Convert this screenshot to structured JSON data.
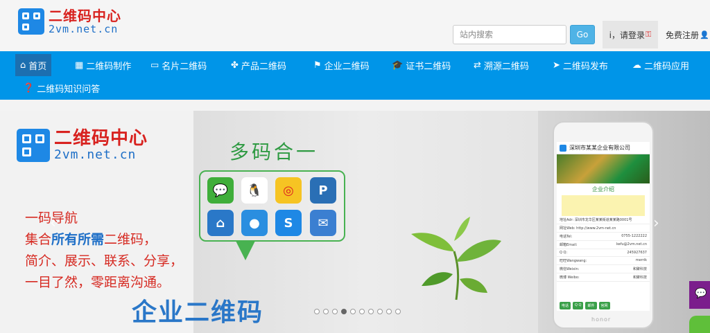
{
  "brand": {
    "cn": "二维码中心",
    "en": "2vm.net.cn"
  },
  "header": {
    "search_placeholder": "站内搜索",
    "go_label": "Go",
    "login_label": "i，请登录",
    "register_label": "免费注册"
  },
  "nav": {
    "items": [
      {
        "icon": "home-icon",
        "label": "首页"
      },
      {
        "icon": "qr-icon",
        "label": "二维码制作"
      },
      {
        "icon": "card-icon",
        "label": "名片二维码"
      },
      {
        "icon": "cubes-icon",
        "label": "产品二维码"
      },
      {
        "icon": "flag-icon",
        "label": "企业二维码"
      },
      {
        "icon": "graduation-icon",
        "label": "证书二维码"
      },
      {
        "icon": "retweet-icon",
        "label": "溯源二维码"
      },
      {
        "icon": "send-icon",
        "label": "二维码发布"
      },
      {
        "icon": "cloud-icon",
        "label": "二维码应用"
      },
      {
        "icon": "question-icon",
        "label": "二维码知识问答"
      }
    ]
  },
  "banner": {
    "logo_cn": "二维码中心",
    "logo_en": "2vm.net.cn",
    "slogan_1": "一码导航",
    "slogan_2a": "集合",
    "slogan_2b": "所有所需",
    "slogan_2c": "二维码，",
    "slogan_3": "简介、展示、联系、分享，",
    "slogan_4": "一目了然，零距离沟通。",
    "big_title": "企业二维码",
    "bubble_title": "多码合一",
    "phone": {
      "company": "深圳市某某企业有限公司",
      "intro_title": "企业介绍",
      "address": "地址Adr:   深圳市龙华区某某街道某某路0001号",
      "web": "网址Web:  http://www.2vm-net.cn",
      "rows": [
        {
          "k": "电话Tel:",
          "v": "0755-1222222"
        },
        {
          "k": "邮箱Email:",
          "v": "kefu@2vm.net.cn"
        },
        {
          "k": "Q Q:",
          "v": "245927637"
        },
        {
          "k": "旺旺Wangwang:",
          "v": "merrik"
        },
        {
          "k": "微信Weixin:",
          "v": "和聚科技"
        },
        {
          "k": "微博 Weibo:",
          "v": "和聚科技"
        }
      ],
      "buttons": [
        "电话",
        "Q Q",
        "邮件",
        "官网"
      ],
      "brand": "honor"
    },
    "dots_total": 10,
    "dots_active_index": 3
  },
  "colors": {
    "nav_bg": "#0095e8",
    "brand_red": "#d8221f",
    "brand_blue": "#1e6fc7"
  }
}
